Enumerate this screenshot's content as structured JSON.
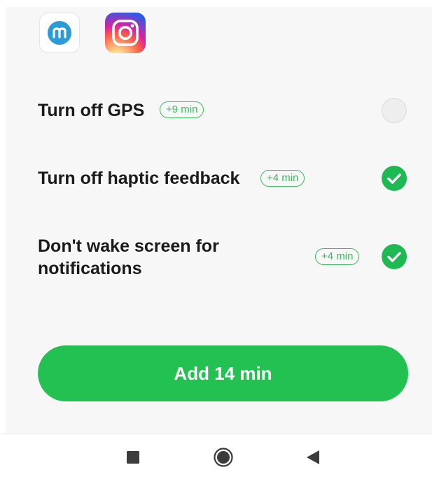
{
  "apps": [
    {
      "name": "mylife-app-icon",
      "icon": "mylife-icon"
    },
    {
      "name": "instagram-app-icon",
      "icon": "instagram-icon"
    }
  ],
  "options": [
    {
      "label": "Turn off GPS",
      "badge": "+9 min",
      "enabled": false
    },
    {
      "label": "Turn off haptic feedback",
      "badge": "+4 min",
      "enabled": true
    },
    {
      "label_line1": "Don't wake screen for",
      "label_line2": "notifications",
      "badge": "+4 min",
      "enabled": true
    }
  ],
  "action": {
    "label": "Add 14 min"
  },
  "nav": {
    "items": [
      "recents-square-icon",
      "home-circle-icon",
      "back-triangle-icon"
    ]
  },
  "colors": {
    "accent": "#22c152",
    "badge": "#3fba5d",
    "background": "#f7f7f7"
  }
}
